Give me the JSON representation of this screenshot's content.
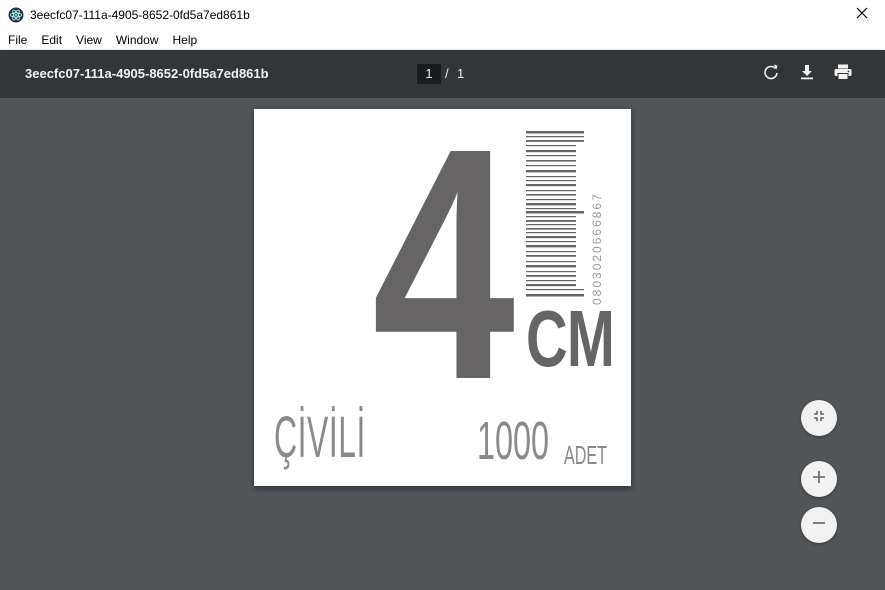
{
  "window": {
    "title": "3eecfc07-111a-4905-8652-0fd5a7ed861b",
    "app_icon": "electron-icon",
    "close_icon": "close-icon"
  },
  "menu": {
    "items": [
      "File",
      "Edit",
      "View",
      "Window",
      "Help"
    ]
  },
  "toolbar": {
    "doc_title": "3eecfc07-111a-4905-8652-0fd5a7ed861b",
    "current_page": "1",
    "separator": "/",
    "total_pages": "1",
    "rotate_icon": "rotate-icon",
    "download_icon": "download-icon",
    "print_icon": "print-icon"
  },
  "document": {
    "size_number": "4",
    "size_unit": "CM",
    "barcode_digits": "0803020666867",
    "product_name": "ÇİVİLİ",
    "quantity": "1000",
    "quantity_unit": "ADET",
    "ink_color": "#666465",
    "light_ink_color": "#8a8a8a"
  },
  "zoom": {
    "fit_icon": "fit-to-page-icon",
    "zoom_in_icon": "zoom-in-icon",
    "zoom_out_icon": "zoom-out-icon"
  },
  "colors": {
    "toolbar_bg": "#323639",
    "viewer_bg": "#525659",
    "toolbar_text": "#f1f1f1"
  }
}
